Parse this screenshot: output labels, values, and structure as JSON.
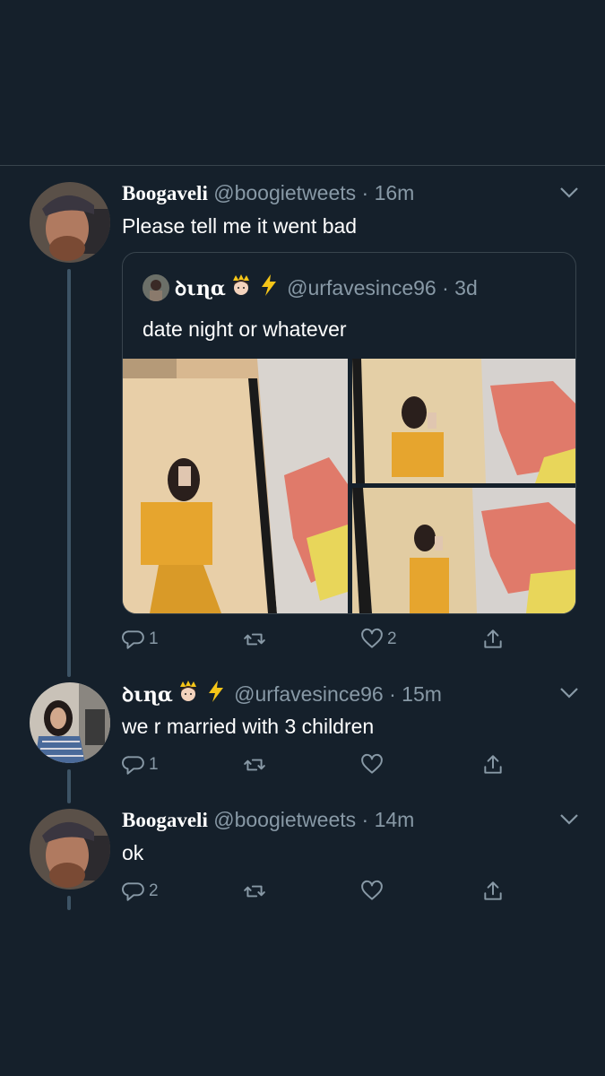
{
  "tweets": [
    {
      "name": "Boogaveli",
      "handle": "@boogietweets",
      "time": "16m",
      "text": "Please tell me it went bad",
      "actions": {
        "reply": "1",
        "retweet": "",
        "like": "2",
        "share": ""
      }
    },
    {
      "name": "ꝺιɳα",
      "handle": "@urfavesince96",
      "time": "15m",
      "text": "we r married with 3 children",
      "actions": {
        "reply": "1",
        "retweet": "",
        "like": "",
        "share": ""
      }
    },
    {
      "name": "Boogaveli",
      "handle": "@boogietweets",
      "time": "14m",
      "text": "ok",
      "actions": {
        "reply": "2",
        "retweet": "",
        "like": "",
        "share": ""
      }
    }
  ],
  "quoted": {
    "name": "ꝺιɳα",
    "handle": "@urfavesince96",
    "time": "3d",
    "text": "date night or whatever",
    "media_count": 3
  },
  "separator": " · ",
  "colors": {
    "background": "#15202b",
    "secondary_text": "#8899a6",
    "border": "#38444d",
    "thread_line": "#3d5466"
  },
  "icons": [
    "reply-icon",
    "retweet-icon",
    "like-icon",
    "share-icon",
    "chevron-down-icon",
    "crown-emoji-icon",
    "lightning-emoji-icon"
  ]
}
